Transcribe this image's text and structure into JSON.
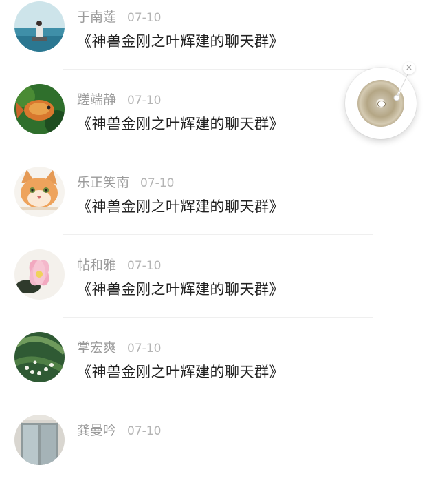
{
  "chat_list": {
    "items": [
      {
        "name": "于南莲",
        "date": "07-10",
        "title": "《神兽金刚之叶辉建的聊天群》",
        "avatar_icon": "sea-portrait-avatar"
      },
      {
        "name": "蹉端静",
        "date": "07-10",
        "title": "《神兽金刚之叶辉建的聊天群》",
        "avatar_icon": "goldfish-avatar"
      },
      {
        "name": "乐正笑南",
        "date": "07-10",
        "title": "《神兽金刚之叶辉建的聊天群》",
        "avatar_icon": "cat-avatar"
      },
      {
        "name": "帖和雅",
        "date": "07-10",
        "title": "《神兽金刚之叶辉建的聊天群》",
        "avatar_icon": "lotus-avatar"
      },
      {
        "name": "掌宏爽",
        "date": "07-10",
        "title": "《神兽金刚之叶辉建的聊天群》",
        "avatar_icon": "lily-of-valley-avatar"
      },
      {
        "name": "龚曼吟",
        "date": "07-10",
        "title": "",
        "avatar_icon": "window-avatar"
      }
    ]
  },
  "float_player": {
    "close_symbol": "×",
    "disc_icon": "vinyl-disc-icon"
  }
}
